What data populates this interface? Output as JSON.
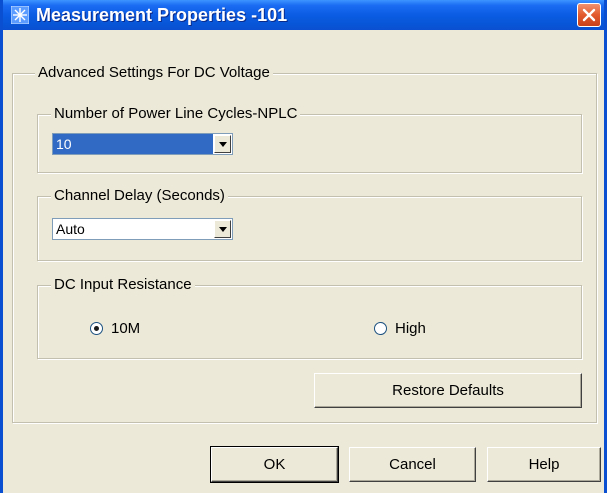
{
  "window": {
    "title": "Measurement Properties -101"
  },
  "group_main": {
    "legend": "Advanced Settings For DC Voltage"
  },
  "nplc": {
    "legend": "Number of Power Line Cycles-NPLC",
    "value": "10"
  },
  "channel_delay": {
    "legend": "Channel Delay (Seconds)",
    "value": "Auto"
  },
  "input_resistance": {
    "legend": "DC Input Resistance",
    "options": [
      {
        "label": "10M",
        "checked": true
      },
      {
        "label": "High",
        "checked": false
      }
    ]
  },
  "buttons": {
    "restore_defaults": "Restore Defaults",
    "ok": "OK",
    "cancel": "Cancel",
    "help": "Help"
  },
  "icons": {
    "title_icon": "app-snowflake-icon",
    "close": "close-icon",
    "dropdown": "chevron-down-icon"
  },
  "colors": {
    "titlebar": "#0a4fd1",
    "selection": "#316ac5",
    "close_button": "#e25a2d",
    "dialog_bg": "#ece9d8"
  }
}
